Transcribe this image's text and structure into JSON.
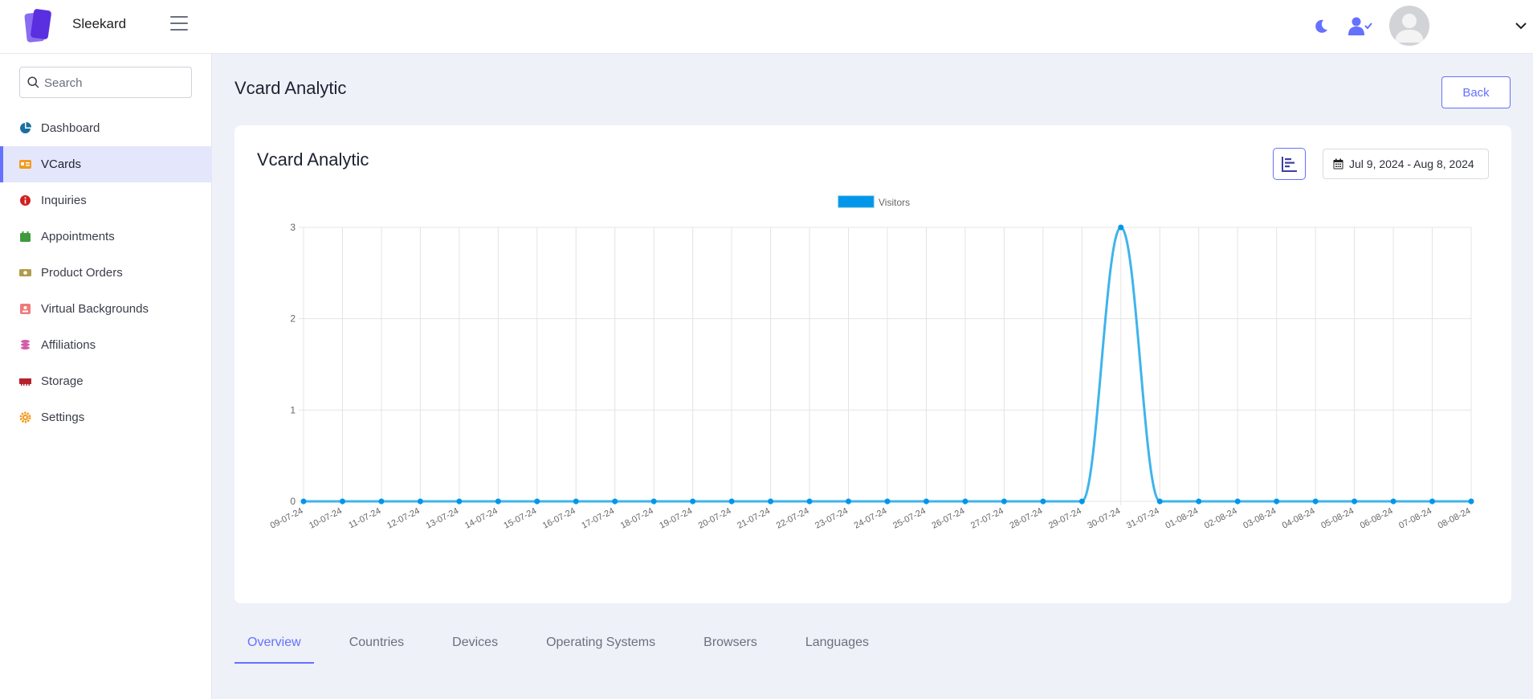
{
  "app": {
    "brand": "Sleekard"
  },
  "colors": {
    "accent": "#6571ff",
    "series": "#3fb4ea",
    "point": "#0096ea"
  },
  "header": {
    "icons": [
      "menu-icon",
      "moon-icon",
      "user-check-icon",
      "avatar",
      "chevron-down-icon"
    ]
  },
  "sidebar": {
    "search_placeholder": "Search",
    "items": [
      {
        "label": "Dashboard",
        "icon": "dashboard-icon",
        "active": false
      },
      {
        "label": "VCards",
        "icon": "vcard-icon",
        "active": true
      },
      {
        "label": "Inquiries",
        "icon": "info-icon",
        "active": false
      },
      {
        "label": "Appointments",
        "icon": "calendar-icon",
        "active": false
      },
      {
        "label": "Product Orders",
        "icon": "money-icon",
        "active": false
      },
      {
        "label": "Virtual Backgrounds",
        "icon": "id-badge-icon",
        "active": false
      },
      {
        "label": "Affiliations",
        "icon": "coins-icon",
        "active": false
      },
      {
        "label": "Storage",
        "icon": "memory-icon",
        "active": false
      },
      {
        "label": "Settings",
        "icon": "gear-icon",
        "active": false
      }
    ]
  },
  "main": {
    "page_title": "Vcard Analytic",
    "back_label": "Back",
    "card_title": "Vcard Analytic",
    "date_range": "Jul 9, 2024 - Aug 8, 2024"
  },
  "tabs": [
    {
      "label": "Overview",
      "active": true
    },
    {
      "label": "Countries",
      "active": false
    },
    {
      "label": "Devices",
      "active": false
    },
    {
      "label": "Operating Systems",
      "active": false
    },
    {
      "label": "Browsers",
      "active": false
    },
    {
      "label": "Languages",
      "active": false
    }
  ],
  "chart_data": {
    "type": "line",
    "legend": "top",
    "grid": true,
    "ylim": [
      0,
      3
    ],
    "yticks": [
      0,
      1,
      2,
      3
    ],
    "categories": [
      "09-07-24",
      "10-07-24",
      "11-07-24",
      "12-07-24",
      "13-07-24",
      "14-07-24",
      "15-07-24",
      "16-07-24",
      "17-07-24",
      "18-07-24",
      "19-07-24",
      "20-07-24",
      "21-07-24",
      "22-07-24",
      "23-07-24",
      "24-07-24",
      "25-07-24",
      "26-07-24",
      "27-07-24",
      "28-07-24",
      "29-07-24",
      "30-07-24",
      "31-07-24",
      "01-08-24",
      "02-08-24",
      "03-08-24",
      "04-08-24",
      "05-08-24",
      "06-08-24",
      "07-08-24",
      "08-08-24"
    ],
    "series": [
      {
        "name": "Visitors",
        "values": [
          0,
          0,
          0,
          0,
          0,
          0,
          0,
          0,
          0,
          0,
          0,
          0,
          0,
          0,
          0,
          0,
          0,
          0,
          0,
          0,
          0,
          3,
          0,
          0,
          0,
          0,
          0,
          0,
          0,
          0,
          0
        ]
      }
    ]
  }
}
